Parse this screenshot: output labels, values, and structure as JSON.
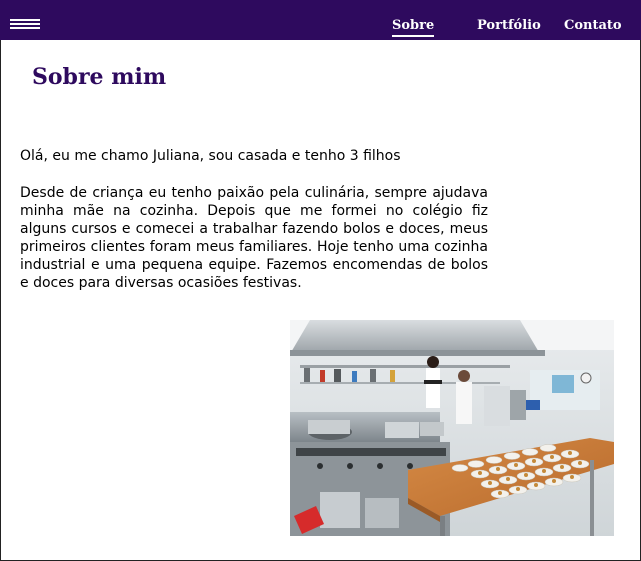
{
  "nav": {
    "menu_icon": "hamburger-menu-icon",
    "links": [
      {
        "label": "Sobre",
        "active": true
      },
      {
        "label": "Portfólio",
        "active": false
      },
      {
        "label": "Contato",
        "active": false
      }
    ]
  },
  "main": {
    "title": "Sobre mim",
    "intro": "Olá, eu me chamo Juliana, sou casada e tenho 3 filhos",
    "bio": "Desde de criança eu tenho paixão pela culinária, sempre ajudava minha mãe na cozinha. Depois que me formei no colégio fiz alguns cursos e comecei a trabalhar fazendo bolos e doces, meus primeiros clientes foram meus familiares. Hoje tenho uma cozinha industrial e uma pequena equipe. Fazemos encomendas de bolos e doces para diversas ocasiões festivas."
  },
  "colors": {
    "nav_background": "#2e0a5e",
    "title_color": "#2e0a5e"
  }
}
